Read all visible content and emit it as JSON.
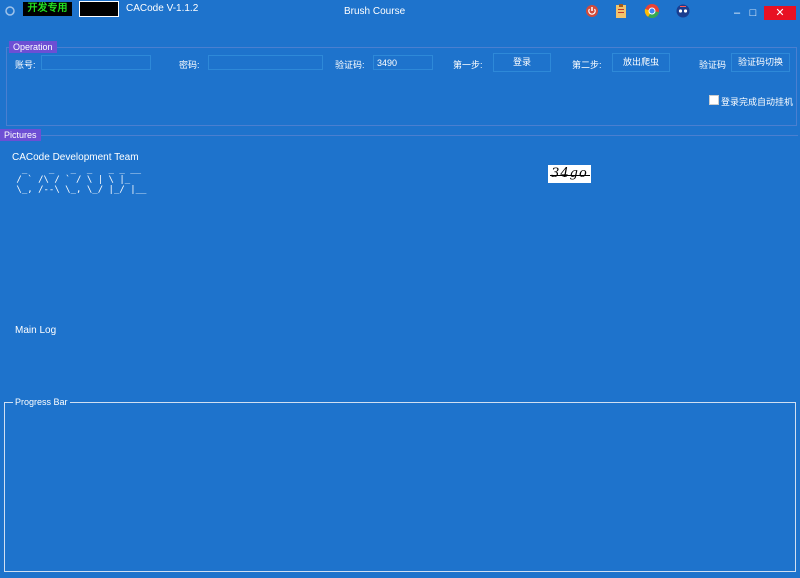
{
  "titlebar": {
    "dev_badge": "开发专用",
    "app_title": "CACode V-1.1.2",
    "center_title": "Brush Course",
    "minimize": "–",
    "maximize": "□",
    "close": "✕"
  },
  "operation": {
    "label": "Operation",
    "account_label": "账号:",
    "account_value": "",
    "password_label": "密码:",
    "password_value": "",
    "captcha_label": "验证码:",
    "captcha_value": "3490",
    "step1_label": "第一步:",
    "login_button": "登录",
    "step2_label": "第二步:",
    "release_button": "放出爬虫",
    "captcha_label2": "验证码",
    "switch_button": "验证码切换",
    "auto_hang_label": "登录完成自动挂机",
    "auto_hang_checked": false
  },
  "pictures": {
    "label": "Pictures",
    "team": "CACode Development Team",
    "ascii_line1": "  _    _   _  _   _ _ __",
    "ascii_line2": " / ` /\\ / ` / \\ | \\ |_ ",
    "ascii_line3": " \\_, /--\\ \\_, \\_/ |_/ |__",
    "captcha_image_text": "34go"
  },
  "main_log": {
    "label": "Main Log"
  },
  "progress": {
    "label": "Progress Bar"
  },
  "colors": {
    "background": "#1e73cc",
    "group_label": "#6d4fd4",
    "close_button": "#e81123",
    "dev_badge_text": "#22e022"
  }
}
